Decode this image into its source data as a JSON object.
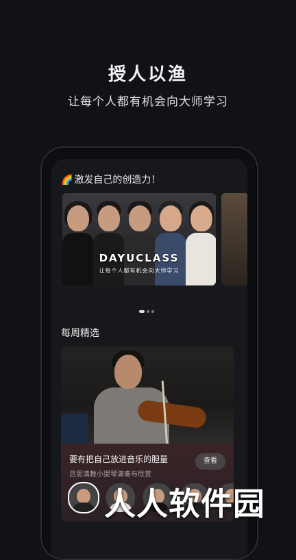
{
  "promo": {
    "title": "授人以渔",
    "subtitle": "让每个人都有机会向大师学习"
  },
  "banner": {
    "emoji": "🌈",
    "heading": "激发自己的创造力！",
    "brand": "DAYUCLASS",
    "brand_tagline": "让每个人都有机会向大师学习",
    "slide_count": 3,
    "active_slide": 1
  },
  "weekly": {
    "title": "每周精选",
    "course": {
      "name": "要有把自己放进音乐的胆量",
      "teacher": "吕思清教小提琴演奏与欣赏",
      "button_label": "查看"
    },
    "avatar_count": 5
  },
  "watermark": "人人软件园"
}
